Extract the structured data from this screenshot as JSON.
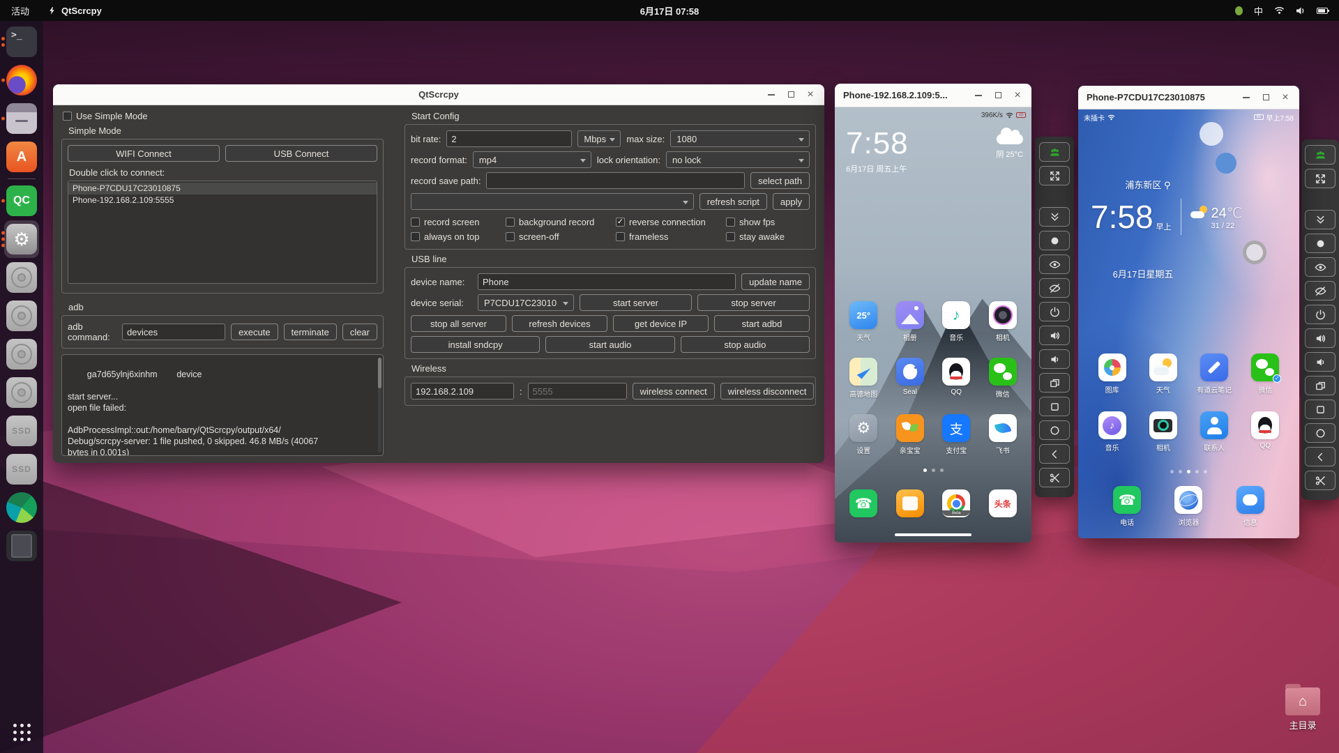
{
  "top_bar": {
    "activities": "活动",
    "app_name": "QtScrcpy",
    "clock": "6月17日 07:58",
    "input_method": "中"
  },
  "dock": {
    "items": [
      {
        "name": "terminal",
        "style": "terminal",
        "dots": 2,
        "glyph": ">_"
      },
      {
        "name": "firefox",
        "style": "firefox",
        "dots": 1
      },
      {
        "name": "files",
        "style": "files",
        "dots": 1
      },
      {
        "name": "ubuntu-software",
        "style": "software",
        "dots": 0
      },
      {
        "name": "separator"
      },
      {
        "name": "qtcreator",
        "style": "qc",
        "dots": 1,
        "glyph": "QC"
      },
      {
        "name": "settings",
        "style": "settings",
        "dots": 3,
        "active": true,
        "glyph": "⚙"
      },
      {
        "name": "disc-1",
        "style": "disc"
      },
      {
        "name": "disc-2",
        "style": "disc"
      },
      {
        "name": "disc-3",
        "style": "disc"
      },
      {
        "name": "disc-4",
        "style": "disc"
      },
      {
        "name": "ssd-1",
        "style": "ssd",
        "glyph": "SSD"
      },
      {
        "name": "ssd-2",
        "style": "ssd",
        "glyph": "SSD"
      },
      {
        "name": "kazam",
        "style": "kazam"
      },
      {
        "name": "tablet-device",
        "style": "tablet"
      },
      {
        "name": "show-applications",
        "style": "showapps",
        "pin_bottom": true
      }
    ]
  },
  "main_window": {
    "title": "QtScrcpy",
    "simple": {
      "use_simple_mode": "Use Simple Mode",
      "group_title": "Simple Mode",
      "wifi_connect": "WIFI Connect",
      "usb_connect": "USB Connect",
      "hint": "Double click to connect:",
      "devices": [
        "Phone-P7CDU17C23010875",
        "Phone-192.168.2.109:5555"
      ]
    },
    "adb": {
      "group_title": "adb",
      "command_label": "adb command:",
      "command_value": "devices",
      "execute": "execute",
      "terminate": "terminate",
      "clear": "clear",
      "log": "ga7d65ylnj6xinhm        device\n\nstart server...\nopen file failed:\n\nAdbProcessImpl::out:/home/barry/QtScrcpy/output/x64/\nDebug/scrcpy-server: 1 file pushed, 0 skipped. 46.8 MB/s (40067\nbytes in 0.001s)"
    },
    "start_config": {
      "group_title": "Start Config",
      "bit_rate_label": "bit rate:",
      "bit_rate_value": "2",
      "bit_rate_unit": "Mbps",
      "max_size_label": "max size:",
      "max_size_value": "1080",
      "record_format_label": "record format:",
      "record_format_value": "mp4",
      "lock_orientation_label": "lock orientation:",
      "lock_orientation_value": "no lock",
      "record_save_path_label": "record save path:",
      "record_save_path_value": "",
      "select_path": "select path",
      "script_combo_value": "",
      "refresh_script": "refresh script",
      "apply": "apply",
      "checkboxes_row1": [
        {
          "label": "record screen",
          "checked": false
        },
        {
          "label": "background record",
          "checked": false
        },
        {
          "label": "reverse connection",
          "checked": true
        },
        {
          "label": "show fps",
          "checked": false
        }
      ],
      "checkboxes_row2": [
        {
          "label": "always on top",
          "checked": false
        },
        {
          "label": "screen-off",
          "checked": false
        },
        {
          "label": "frameless",
          "checked": false
        },
        {
          "label": "stay awake",
          "checked": false
        }
      ]
    },
    "usb_line": {
      "group_title": "USB line",
      "device_name_label": "device name:",
      "device_name_value": "Phone",
      "update_name": "update name",
      "device_serial_label": "device serial:",
      "device_serial_value": "P7CDU17C23010",
      "start_server": "start server",
      "stop_server": "stop server",
      "row3": [
        "stop all server",
        "refresh devices",
        "get device IP",
        "start adbd"
      ],
      "row4": [
        "install sndcpy",
        "start audio",
        "stop audio"
      ]
    },
    "wireless": {
      "group_title": "Wireless",
      "ip_value": "192.168.2.109",
      "colon": ":",
      "port_placeholder": "5555",
      "connect": "wireless connect",
      "disconnect": "wireless disconnect"
    }
  },
  "toolbar": {
    "buttons": [
      {
        "icon": "group-icon",
        "green": true
      },
      {
        "icon": "fullscreen-icon"
      },
      {
        "icon": "collapse-icon",
        "gap": true
      },
      {
        "icon": "touch-icon"
      },
      {
        "icon": "screen-on-icon"
      },
      {
        "icon": "screen-off-icon"
      },
      {
        "icon": "power-icon"
      },
      {
        "icon": "volume-up-icon"
      },
      {
        "icon": "volume-down-icon"
      },
      {
        "icon": "app-switch-icon"
      },
      {
        "icon": "menu-icon"
      },
      {
        "icon": "home-icon"
      },
      {
        "icon": "back-icon"
      },
      {
        "icon": "screenshot-icon"
      }
    ]
  },
  "phone1": {
    "title": "Phone-192.168.2.109:5...",
    "status": {
      "net_speed": "396K/s",
      "battery": "10"
    },
    "clock": "7:58",
    "date": "6月17日 周五上午",
    "weather": "阴  25°C",
    "app_rows": [
      [
        {
          "label": "天气",
          "style": "tianqi",
          "glyph": "25°"
        },
        {
          "label": "相册",
          "style": "xiangce"
        },
        {
          "label": "音乐",
          "style": "yinyue",
          "glyph": "♪"
        },
        {
          "label": "相机",
          "style": "xiangji"
        }
      ],
      [
        {
          "label": "高德地图",
          "style": "gaode"
        },
        {
          "label": "Seal",
          "style": "seal"
        },
        {
          "label": "QQ",
          "style": "qq"
        },
        {
          "label": "微信",
          "style": "weixin"
        }
      ],
      [
        {
          "label": "设置",
          "style": "shezhi",
          "glyph": "⚙"
        },
        {
          "label": "亲宝宝",
          "style": "qinbaobao"
        },
        {
          "label": "支付宝",
          "style": "zhifubao",
          "glyph": "支"
        },
        {
          "label": "飞书",
          "style": "feishu"
        }
      ]
    ],
    "dock": [
      {
        "label": "",
        "style": "dianhua",
        "glyph": "☎",
        "name": "phone-app"
      },
      {
        "label": "",
        "style": "mms",
        "name": "messaging-app"
      },
      {
        "label": "",
        "style": "chrome",
        "badge": "Beta",
        "name": "chrome-app"
      },
      {
        "label": "",
        "style": "toutiao",
        "glyph": "头条",
        "name": "toutiao-app"
      }
    ],
    "dots": {
      "count": 3,
      "active": 0
    }
  },
  "phone2": {
    "title": "Phone-P7CDU17C23010875",
    "status": {
      "sim": "未插卡",
      "battery": "90",
      "time": "早上7:58"
    },
    "location": "浦东新区",
    "clock": "7:58",
    "ampm": "早上",
    "temp": "24℃",
    "hilo": "31 / 22",
    "date": "6月17日星期五",
    "app_rows": [
      [
        {
          "label": "图库",
          "style": "tuku"
        },
        {
          "label": "天气",
          "style": "tianqi2"
        },
        {
          "label": "有道云笔记",
          "style": "youdao"
        },
        {
          "label": "微信",
          "style": "weixin",
          "badge_check": true
        }
      ],
      [
        {
          "label": "音乐",
          "style": "yinyue2",
          "glyph": "♪"
        },
        {
          "label": "相机",
          "style": "xiangji2"
        },
        {
          "label": "联系人",
          "style": "lianxiren"
        },
        {
          "label": "QQ",
          "style": "qq"
        }
      ]
    ],
    "dock": [
      {
        "label": "电话",
        "style": "dianhua",
        "glyph": "☎",
        "name": "phone-app"
      },
      {
        "label": "浏览器",
        "style": "liulanqi",
        "name": "browser-app"
      },
      {
        "label": "信息",
        "style": "xinxi",
        "name": "messages-app"
      }
    ],
    "dots": {
      "count": 5,
      "active": 2
    }
  },
  "desktop": {
    "home_label": "主目录"
  }
}
